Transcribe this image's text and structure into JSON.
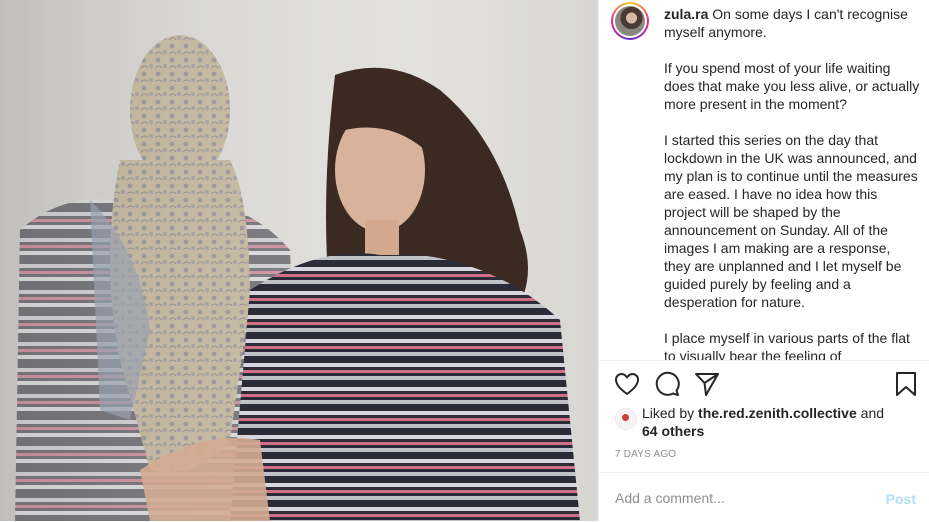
{
  "post": {
    "username": "zula.ra",
    "caption_paragraphs": [
      "On some days I can't recognise myself anymore.",
      "If you spend most of your life waiting does that make you less alive, or actually more present in the moment?",
      "I started this series on the day that lockdown in the UK was announced, and my plan is to continue until the measures are eased. I have no idea how this project will be shaped by the announcement on Sunday. All of the images I am making are a response, they are unplanned and I let myself be guided purely by feeling and a desperation for nature.",
      "I place myself in various parts of the flat to visually bear the feeling of"
    ],
    "liked_by_prefix": "Liked by",
    "liked_by_user": "the.red.zenith.collective",
    "liked_by_and": "and",
    "others_count": "64 others",
    "timestamp": "7 days ago",
    "comment_placeholder": "Add a comment...",
    "post_button": "Post"
  },
  "icons": {
    "like": "heart-icon",
    "comment": "comment-bubble-icon",
    "share": "paper-plane-icon",
    "save": "bookmark-icon"
  },
  "colors": {
    "text": "#262626",
    "muted": "#8e8e8e",
    "post_button_disabled": "#b2dffc",
    "divider": "#efefef"
  }
}
